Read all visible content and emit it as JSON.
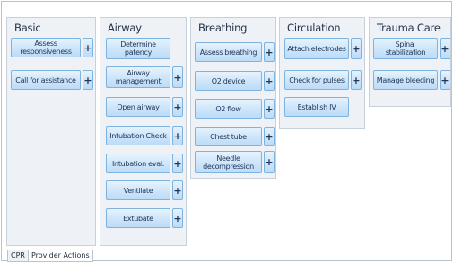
{
  "panels": {
    "basic": {
      "title": "Basic",
      "buttons": [
        "Assess responsiveness",
        "Call for assistance"
      ]
    },
    "airway": {
      "title": "Airway",
      "buttons": [
        "Determine patency",
        "Airway management",
        "Open airway",
        "Intubation Check",
        "Intubation eval.",
        "Ventilate",
        "Extubate"
      ]
    },
    "breathing": {
      "title": "Breathing",
      "buttons": [
        "Assess breathing",
        "O2 device",
        "O2 flow",
        "Chest tube",
        "Needle decompression"
      ]
    },
    "circulation": {
      "title": "Circulation",
      "buttons": [
        "Attach electrodes",
        "Check for pulses",
        "Establish IV"
      ]
    },
    "trauma": {
      "title": "Trauma Care",
      "buttons": [
        "Spinal stabilization",
        "Manage bleeding"
      ]
    }
  },
  "plus_label": "+",
  "tabs": [
    "CPR",
    "Provider Actions"
  ]
}
